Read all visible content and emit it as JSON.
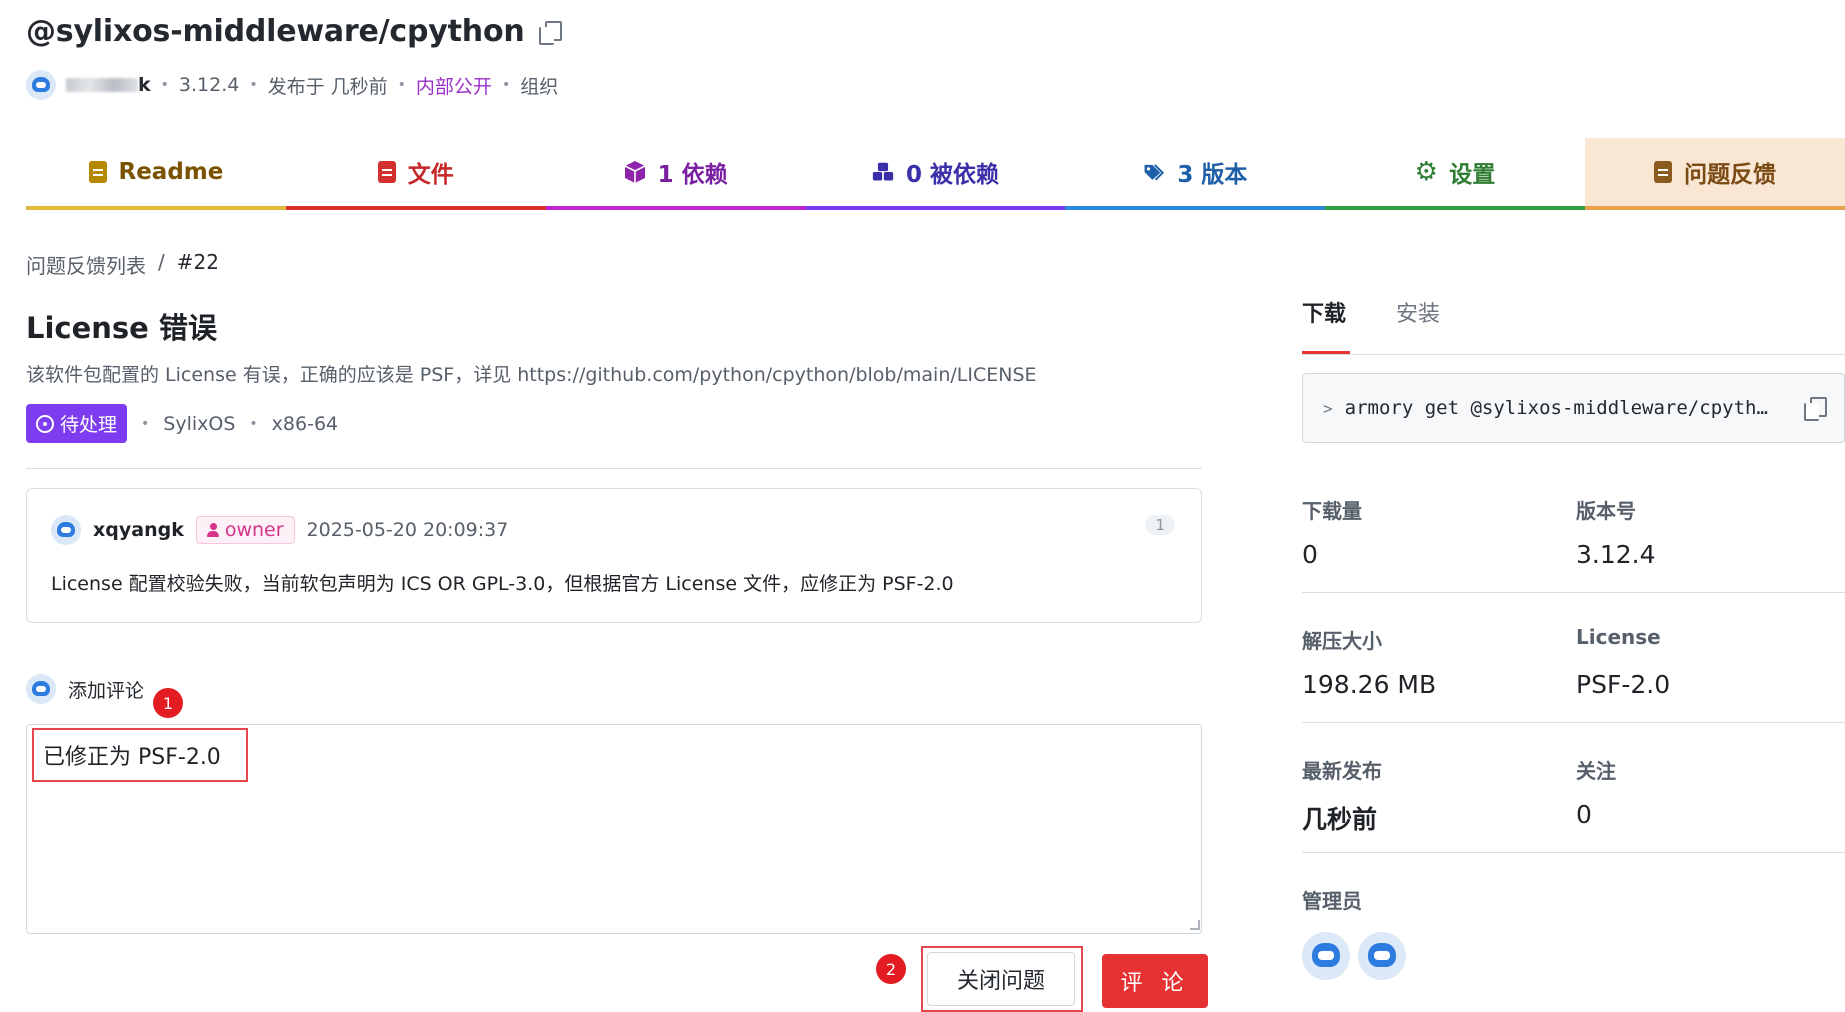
{
  "header": {
    "package_name": "@sylixos-middleware/cpython",
    "author_visible_tail": "k",
    "version": "3.12.4",
    "published": "发布于 几秒前",
    "visibility": "内部公开",
    "scope": "组织"
  },
  "tabs": [
    {
      "label": "Readme",
      "icon": "document-icon",
      "color": "#7a5200",
      "line": "#e0b93a"
    },
    {
      "label": "文件",
      "icon": "code-file-icon",
      "color": "#c62828",
      "line": "#d93025"
    },
    {
      "label": "1 依赖",
      "icon": "package-icon",
      "color": "#7b1fa2",
      "line": "#c026d3"
    },
    {
      "label": "0 被依赖",
      "icon": "packages-icon",
      "color": "#3a2fa8",
      "line": "#7c3aed"
    },
    {
      "label": "3 版本",
      "icon": "tags-icon",
      "color": "#1d5fa8",
      "line": "#2b8ad9"
    },
    {
      "label": "设置",
      "icon": "gear-icon",
      "color": "#2e7d32",
      "line": "#2ea043"
    },
    {
      "label": "问题反馈",
      "icon": "issue-file-icon",
      "color": "#7a4a14",
      "line": "#e9a04a",
      "active": true
    }
  ],
  "breadcrumb": {
    "parent": "问题反馈列表",
    "separator": "/",
    "current": "#22"
  },
  "issue": {
    "title": "License 错误",
    "description": "该软件包配置的 License 有误，正确的应该是 PSF，详见 https://github.com/python/cpython/blob/main/LICENSE",
    "status": "待处理",
    "os": "SylixOS",
    "arch": "x86-64"
  },
  "comment": {
    "user": "xqyangk",
    "role": "owner",
    "time": "2025-05-20 20:09:37",
    "count": "1",
    "body": "License 配置校验失败，当前软包声明为 ICS OR GPL-3.0，但根据官方 License 文件，应修正为 PSF-2.0"
  },
  "compose": {
    "label": "添加评论",
    "text": "已修正为 PSF-2.0",
    "step1": "1",
    "step2": "2",
    "close_label": "关闭问题",
    "submit_label": "评 论"
  },
  "sidebar": {
    "tab_download": "下载",
    "tab_install": "安装",
    "command": "armory get @sylixos-middleware/cpyth…",
    "stats": [
      {
        "label": "下载量",
        "value": "0"
      },
      {
        "label": "版本号",
        "value": "3.12.4"
      },
      {
        "label": "解压大小",
        "value": "198.26 MB"
      },
      {
        "label": "License",
        "value": "PSF-2.0"
      },
      {
        "label": "最新发布",
        "value": "几秒前"
      },
      {
        "label": "关注",
        "value": "0"
      }
    ],
    "admins_label": "管理员"
  },
  "colors": {
    "accent_red": "#e63232",
    "status_purple": "#7d3cf0",
    "visibility_purple": "#9b2fc9",
    "owner_pink": "#d6338b"
  }
}
